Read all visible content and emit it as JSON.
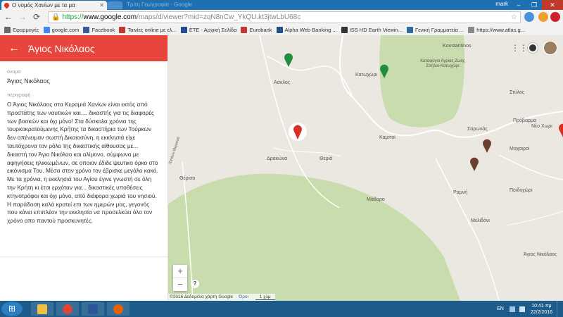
{
  "browser": {
    "tab_title": "Ο νομός Χανίων με τα μα",
    "ghost_tab": "Τρίτη Γεωγραφία · Google",
    "user_label": "mark",
    "url_scheme": "https://",
    "url_host": "www.google.com",
    "url_path": "/maps/d/viewer?mid=zqN8nCw_YkQU.kt3jtwLbU68c",
    "back_icon": "←",
    "forward_icon": "→",
    "reload_icon": "⟳",
    "close_icon": "✕",
    "minimize_icon": "–",
    "maximize_icon": "❐",
    "star_icon": "☆"
  },
  "bookmarks": [
    {
      "label": "Εφαρμογές",
      "color": "#6a6a6a"
    },
    {
      "label": "google.com",
      "color": "#4285f4"
    },
    {
      "label": "Facebook",
      "color": "#3b5998"
    },
    {
      "label": "Ταινίες online με ελ...",
      "color": "#c0392b"
    },
    {
      "label": "ΕΤΕ - Αρχική Σελίδα",
      "color": "#1f4e8c"
    },
    {
      "label": "Eurobank",
      "color": "#c0392b"
    },
    {
      "label": "Alpha Web Banking ...",
      "color": "#1f4e8c"
    },
    {
      "label": "ISS HD Earth Viewin...",
      "color": "#333"
    },
    {
      "label": "Γενική Γραμματεία ...",
      "color": "#2c6aa0"
    },
    {
      "label": "https://www.atlas.g...",
      "color": "#888"
    }
  ],
  "panel": {
    "title": "Άγιος Νικόλαος",
    "back_icon": "←",
    "name_label": "όνομα",
    "name_value": "Άγιος Νικόλαος",
    "desc_label": "περιγραφή",
    "description": "Ο Άγιος Νικόλαος στα Κεραμιά Χανίων είναι εκτός από προστάτης των ναυτικών και.... δικαστής για τις διαφορές των βοσκών και όχι μόνο! Στα δύσκολα χρόνια της τουρκοκρατούμενης Κρήτης τα δικαστήρια των Τούρκων δεν απένειμαν σωστή Δικαιοσύνη, η εκκλησιά είχε ταυτόχρονα τον ρόλο της δικαστικής αίθουσας με...  δικαστή τον Άγιο Νικόλαο και αλίμονο, σύμφωνα με αφηγήσεις ηλικιωμένων, σε οποιον έδιδε ψευτικο όρκο στο εικόνισμα Του. Μέσα στον χρόνο τον έβρισκε μεγάλο κακό. Με τα χρόνια, η εκκλησιά του Αγίου έγινε γνωστή σε όλη την Κρήτη κι έτσι ερχόταν για... δικαστικές υποθέσεις κτηνοτρόφοι και όχι μόνο, από διάφορα χωριά του νησιού. Η παράδοση καλά κρατεί επι των ημερών μας, γεγονός που κάνει επιπλέον την εκκλησία να προσελκύει όλο τον χρόνο απο παντού προσκυνητές."
  },
  "map": {
    "labels": {
      "konstantinos": "Konstantinos",
      "reserve": "Καταφύγιο Άγριας Ζωής Σπήλιο-Κατωχώρι",
      "asklos": "Ασκλος",
      "katochori": "Κατωχώρι",
      "stylos": "Στύλος",
      "sarpnas": "Σαρωνάς",
      "provarma": "Πρόβαρμα",
      "neo_horio": "Νέο Χωρι",
      "kampoi": "Καμποί",
      "macherioi": "Μαχαιροί",
      "drakona": "Δρακώνα",
      "theria": "Θεριά",
      "therso": "Θέρισο",
      "road": "Χανίων-Θερισού",
      "ramni": "Ραμνή",
      "mathro": "Μάθαρο",
      "poidochori": "Ποιδοχώρι",
      "melissoi": "Μελιδόνι",
      "agios_nikolaos": "Άγιος Νικόλαος"
    },
    "zoom_in": "+",
    "zoom_out": "−",
    "help": "?",
    "attribution": "©2016 Δεδομένα χάρτη Google",
    "terms": "Όροι",
    "scale": "1 χλμ",
    "grid_icon": "⋮⋮⋮"
  },
  "taskbar": {
    "start_icon": "⊞",
    "lang": "EN",
    "time": "10:41 πμ",
    "date": "22/2/2016"
  },
  "colors": {
    "header_red": "#e8453c",
    "forest_green": "#c8dcad",
    "pin_red": "#d93025",
    "pin_green": "#1e8e3e",
    "pin_brown": "#6d3f2e"
  }
}
